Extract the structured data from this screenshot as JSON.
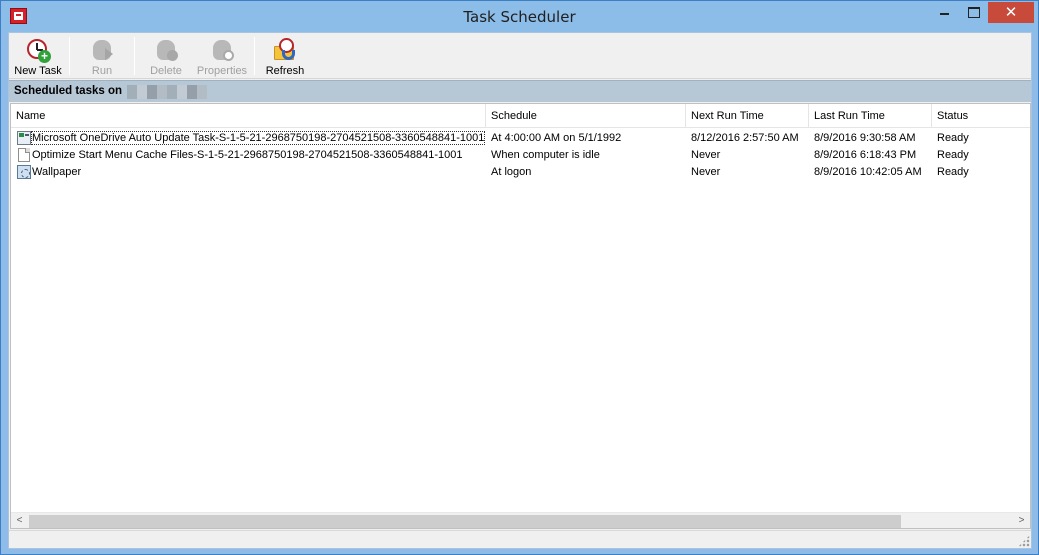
{
  "window": {
    "title": "Task Scheduler",
    "close_glyph": "✕"
  },
  "toolbar": {
    "new_task": "New Task",
    "run": "Run",
    "delete": "Delete",
    "properties": "Properties",
    "refresh": "Refresh"
  },
  "band": {
    "label": "Scheduled tasks on"
  },
  "table": {
    "columns": {
      "name": "Name",
      "schedule": "Schedule",
      "next_run": "Next Run Time",
      "last_run": "Last Run Time",
      "status": "Status"
    },
    "rows": [
      {
        "icon": "task-icon",
        "name": "Microsoft OneDrive Auto Update Task-S-1-5-21-2968750198-2704521508-3360548841-1001",
        "schedule": "At 4:00:00 AM on 5/1/1992",
        "next_run": "8/12/2016 2:57:50 AM",
        "last_run": "8/9/2016 9:30:58 AM",
        "status": "Ready"
      },
      {
        "icon": "document-icon",
        "name": "Optimize Start Menu Cache Files-S-1-5-21-2968750198-2704521508-3360548841-1001",
        "schedule": "When computer is idle",
        "next_run": "Never",
        "last_run": "8/9/2016 6:18:43 PM",
        "status": "Ready"
      },
      {
        "icon": "wallpaper-icon",
        "name": "Wallpaper",
        "schedule": "At logon",
        "next_run": "Never",
        "last_run": "8/9/2016 10:42:05 AM",
        "status": "Ready"
      }
    ]
  },
  "scrollbar": {
    "left_arrow": "<",
    "right_arrow": ">"
  },
  "colors": {
    "title_bar": "#8cbde9",
    "close_button": "#c74a3b",
    "header_band": "#b6c7d6"
  }
}
